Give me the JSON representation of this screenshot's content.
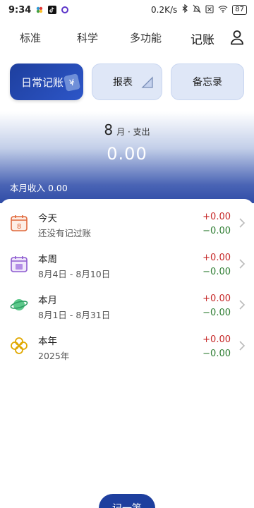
{
  "status": {
    "time": "9:34",
    "speed": "0.2K/s",
    "battery": "87"
  },
  "nav": {
    "tabs": [
      "标准",
      "科学",
      "多功能",
      "记账"
    ],
    "active_index": 3
  },
  "actions": {
    "daily": "日常记账",
    "report": "报表",
    "memo": "备忘录"
  },
  "summary": {
    "month": "8",
    "month_suffix": "月 · 支出",
    "expense": "0.00",
    "income_label": "本月收入",
    "income_value": "0.00"
  },
  "periods": [
    {
      "title": "今天",
      "subtitle": "还没有记过账",
      "income": "+0.00",
      "expense": "−0.00",
      "icon": "calendar-day-icon"
    },
    {
      "title": "本周",
      "subtitle": "8月4日 - 8月10日",
      "income": "+0.00",
      "expense": "−0.00",
      "icon": "calendar-week-icon"
    },
    {
      "title": "本月",
      "subtitle": "8月1日 - 8月31日",
      "income": "+0.00",
      "expense": "−0.00",
      "icon": "planet-icon"
    },
    {
      "title": "本年",
      "subtitle": "2025年",
      "income": "+0.00",
      "expense": "−0.00",
      "icon": "clover-icon"
    }
  ],
  "fab_label": "记一笔",
  "colors": {
    "accent": "#1e3f9e",
    "income": "#c62828",
    "expense": "#2e7d32"
  }
}
